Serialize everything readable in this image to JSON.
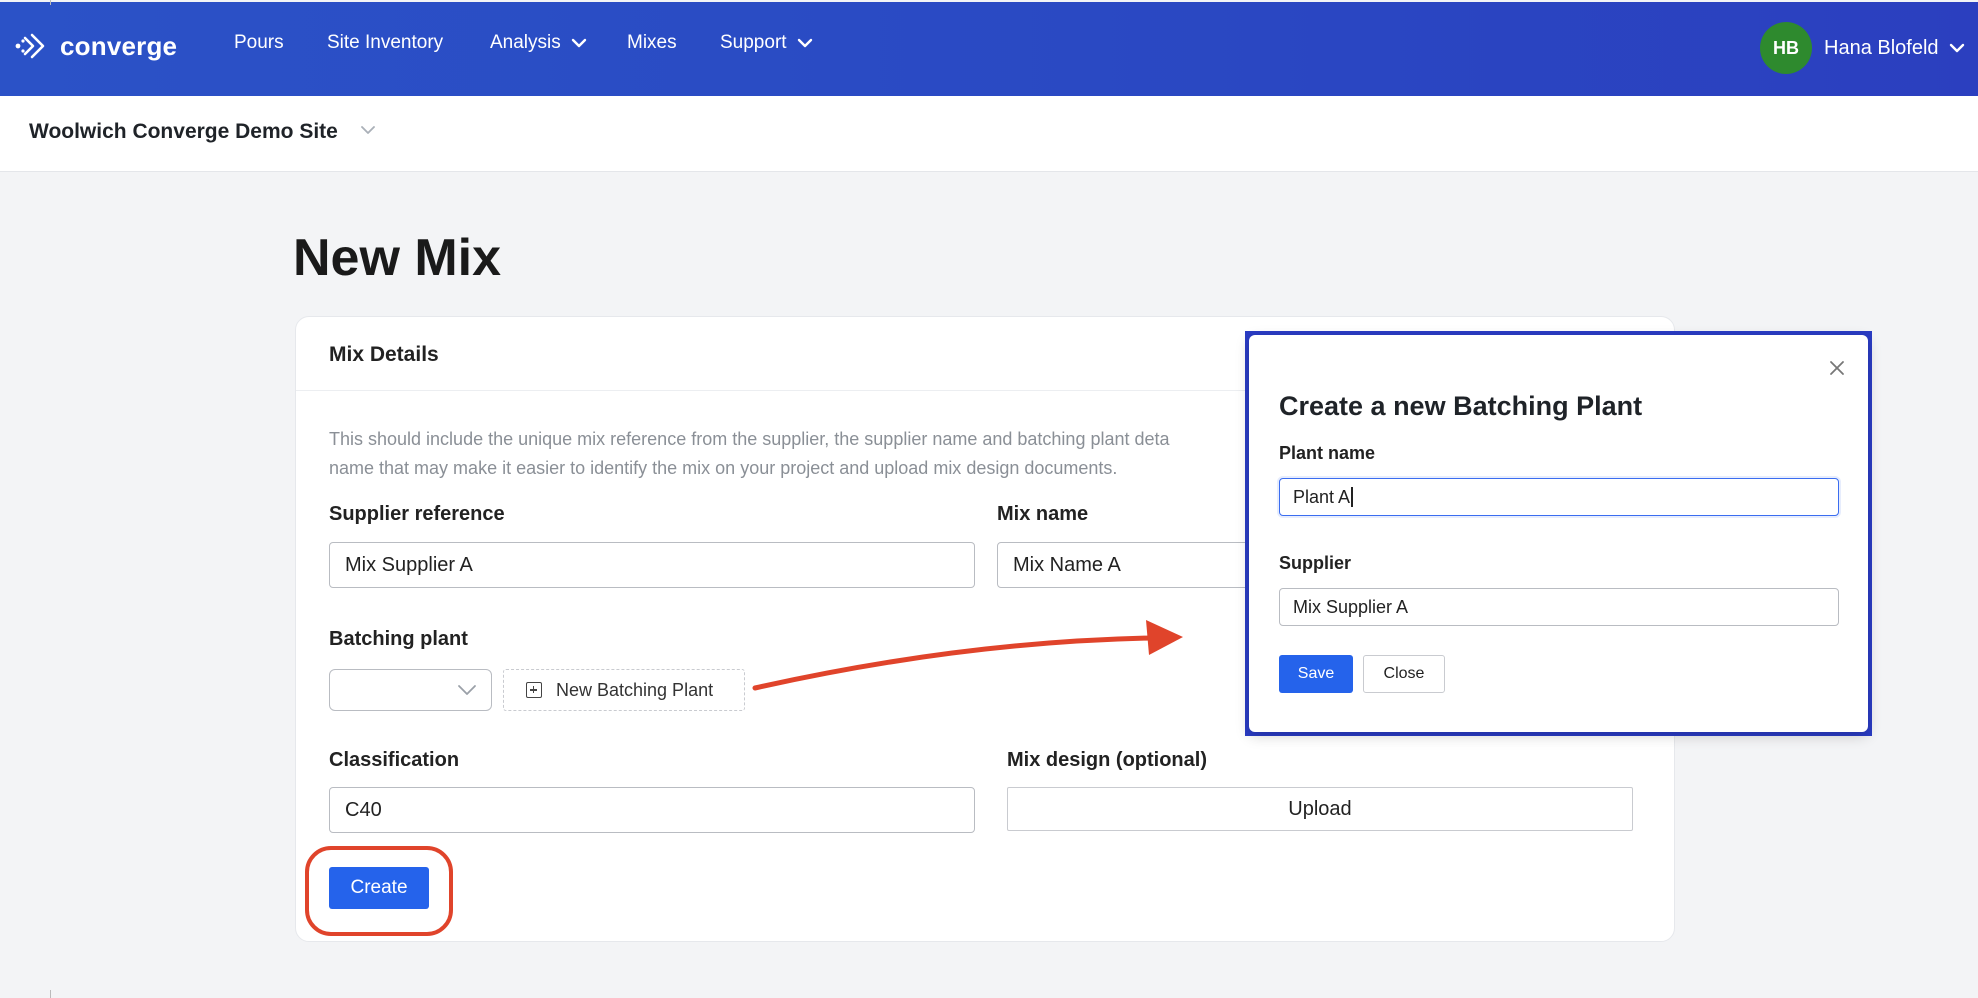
{
  "nav": {
    "brand": "converge",
    "items": [
      {
        "label": "Pours",
        "has_dropdown": false
      },
      {
        "label": "Site Inventory",
        "has_dropdown": false
      },
      {
        "label": "Analysis",
        "has_dropdown": true
      },
      {
        "label": "Mixes",
        "has_dropdown": false
      },
      {
        "label": "Support",
        "has_dropdown": true
      }
    ],
    "user": {
      "initials": "HB",
      "name": "Hana Blofeld",
      "avatar_color": "#2e8a2e"
    }
  },
  "site": {
    "name": "Woolwich Converge Demo Site"
  },
  "page": {
    "title": "New Mix"
  },
  "card": {
    "title": "Mix Details",
    "description_line1": "This should include the unique mix reference from the supplier, the supplier name and batching plant deta",
    "description_line2": "name that may make it easier to identify the mix on your project and upload mix design documents.",
    "supplier_reference": {
      "label": "Supplier reference",
      "value": "Mix Supplier A"
    },
    "mix_name": {
      "label": "Mix name",
      "value": "Mix Name A"
    },
    "batching_plant": {
      "label": "Batching plant",
      "value": "",
      "new_button": "New Batching Plant"
    },
    "classification": {
      "label": "Classification",
      "value": "C40"
    },
    "mix_design": {
      "label": "Mix design (optional)",
      "upload_button": "Upload"
    },
    "create_button": "Create"
  },
  "modal": {
    "title": "Create a new Batching Plant",
    "plant_name": {
      "label": "Plant name",
      "value": "Plant A"
    },
    "supplier": {
      "label": "Supplier",
      "value": "Mix Supplier A"
    },
    "save_button": "Save",
    "close_button": "Close"
  },
  "colors": {
    "nav_gradient_start": "#2b52c7",
    "nav_gradient_end": "#2b3fbf",
    "primary_button": "#2563eb",
    "annotation_red": "#e0442b",
    "modal_border": "#2a3cc4"
  }
}
